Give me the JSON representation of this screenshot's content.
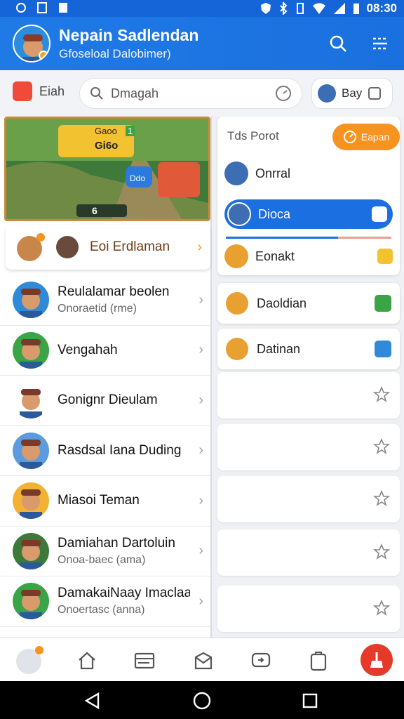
{
  "status_bar": {
    "time": "08:30"
  },
  "header": {
    "title": "Nepain Sadlendan",
    "subtitle": "Gfoseloal Dalobimer)"
  },
  "search_row": {
    "chat_label": "Eiah",
    "search_placeholder": "Dmagah",
    "me_label": "Bay"
  },
  "game_card": {
    "badge_top": "Gaoo",
    "badge_top_num": "1",
    "badge_mid": "Gi6o",
    "chip_label": "Ddo",
    "counter": "6"
  },
  "featured": {
    "name": "Eoi Erdlaman"
  },
  "contacts": [
    {
      "name": "Reulalamar beolen",
      "sub": "Onoraetid (rme)",
      "color": "#2f8ad9"
    },
    {
      "name": "Vengahah",
      "sub": "",
      "color": "#3aa447"
    },
    {
      "name": "Gonignr Dieulam",
      "sub": "",
      "color": "#ffffff"
    },
    {
      "name": "Rasdsal Iana Duding",
      "sub": "",
      "color": "#5b9be0"
    },
    {
      "name": "Miasoi Teman",
      "sub": "",
      "color": "#f2b233"
    },
    {
      "name": "Damiahan Dartoluin",
      "sub": "Onoa-baec (ama)",
      "color": "#3d7a3a"
    },
    {
      "name": "DamakaiNaay Imaclaa",
      "sub": "Onoertasc (anna)",
      "color": "#3aa447"
    }
  ],
  "right_panel": {
    "title": "Tds Porot",
    "open_label": "Eapan",
    "rows": [
      {
        "name": "Onrral",
        "color": "#3d6db3"
      },
      {
        "name": "Dioca",
        "color": "#3d6db3"
      },
      {
        "name": "Eonakt",
        "color": "#e8a030"
      }
    ],
    "progress": 0.68
  },
  "right_cards": [
    {
      "name": "Daoldian",
      "color": "#e8a030",
      "tail": "#3aa447"
    },
    {
      "name": "Datinan",
      "color": "#e8a030",
      "tail": "#2f8ad9"
    }
  ],
  "icons": [
    "search-icon",
    "list-icon",
    "home-icon",
    "card-icon",
    "mail-icon",
    "chat-icon",
    "wallet-icon",
    "broom-icon",
    "star-icon"
  ]
}
